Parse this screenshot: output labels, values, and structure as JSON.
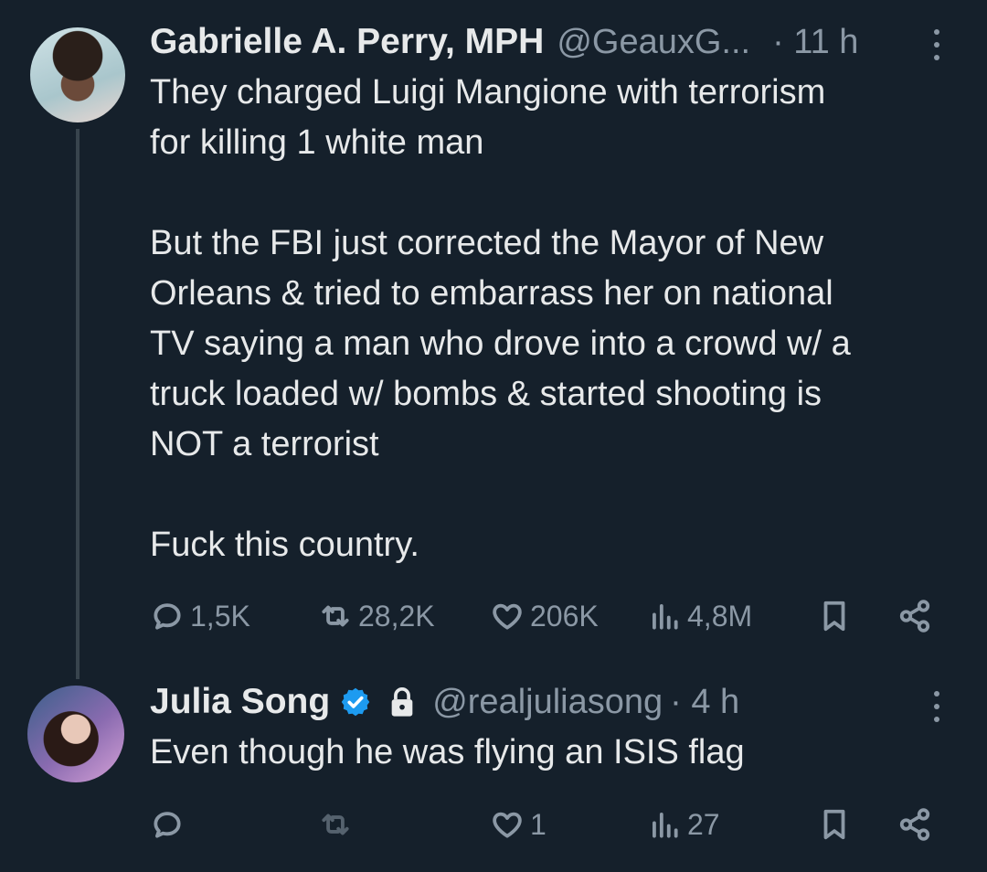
{
  "tweets": [
    {
      "author_name": "Gabrielle A. Perry, MPH",
      "handle": "@GeauxG...",
      "time": "· 11 h",
      "text": "They charged Luigi Mangione with terrorism\nfor killing 1 white man\n\nBut the FBI just corrected the Mayor of New\nOrleans & tried to embarrass her on national\nTV saying a man who drove into a crowd w/ a\ntruck loaded w/ bombs & started shooting is\nNOT a terrorist\n\nFuck this country.",
      "replies": "1,5K",
      "reposts": "28,2K",
      "likes": "206K",
      "views": "4,8M"
    },
    {
      "author_name": "Julia Song",
      "verified": true,
      "protected": true,
      "handle": "@realjuliasong",
      "time": "· 4 h",
      "text": "Even though he was flying an ISIS flag",
      "replies": "",
      "reposts": "",
      "likes": "1",
      "views": "27"
    }
  ],
  "colors": {
    "background": "#15202b",
    "text": "#e7e9ea",
    "muted": "#8b98a5",
    "verified": "#1d9bf0",
    "thread_line": "#38444d"
  }
}
